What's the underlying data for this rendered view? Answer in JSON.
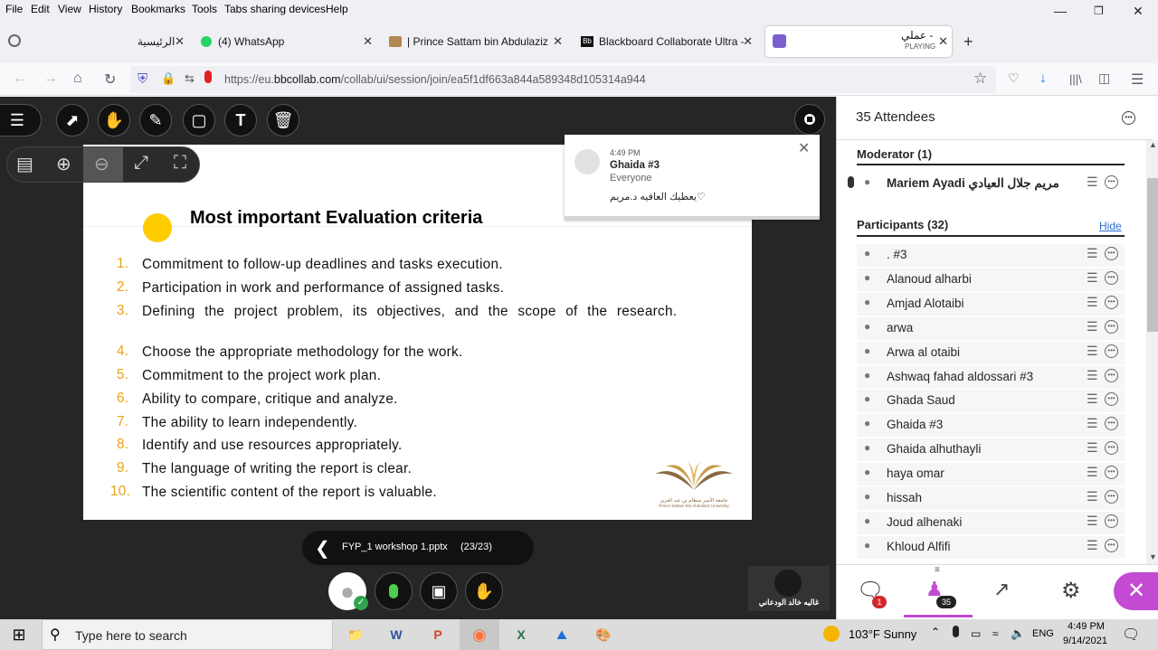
{
  "menubar": {
    "items": [
      "File",
      "Edit",
      "View",
      "History",
      "Bookmarks",
      "Tools",
      "Tabs sharing devices",
      "Help"
    ]
  },
  "tabs": [
    {
      "label": "الرئيسية",
      "icon": "green-leaf-icon"
    },
    {
      "label": "(4) WhatsApp",
      "icon": "whatsapp-icon"
    },
    {
      "label": "| Prince Sattam bin Abdulaziz Un",
      "icon": "university-logo-icon"
    },
    {
      "label": "Blackboard Collaborate Ultra - ...",
      "icon": "blackboard-icon"
    },
    {
      "label": "عملي -",
      "sublabel": "PLAYING",
      "icon": "purple-app-icon"
    }
  ],
  "navbar": {
    "url_host": "https://eu.",
    "url_domain": "bbcollab.com",
    "url_path": "/collab/ui/session/join/ea5f1df663a844a589348d105314a944"
  },
  "notification": {
    "time": "4:49 PM",
    "sender": "Ghaida #3",
    "audience": "Everyone",
    "message": "يعطيك العافيه د.مريم♡"
  },
  "slide": {
    "title": "Most important Evaluation criteria",
    "items": [
      {
        "num": "1.",
        "text": "Commitment to follow-up deadlines and tasks execution."
      },
      {
        "num": "2.",
        "text": "Participation in work and performance of assigned tasks."
      },
      {
        "num": "3.",
        "text": "Defining the project problem, its objectives, and the scope of the research."
      },
      {
        "num": "4.",
        "text": "Choose the appropriate methodology for the work."
      },
      {
        "num": "5.",
        "text": "Commitment to the project work plan."
      },
      {
        "num": "6.",
        "text": "Ability to compare, critique and analyze."
      },
      {
        "num": "7.",
        "text": "The ability to learn independently."
      },
      {
        "num": "8.",
        "text": "Identify and use resources appropriately."
      },
      {
        "num": "9.",
        "text": "The language of writing the report is clear."
      },
      {
        "num": "10.",
        "text": "The scientific content of the report is valuable."
      }
    ],
    "logo_text_ar": "جامعة الأمير سطام بن عبد العزيز",
    "logo_text_en": "Prince Sattam Bin Abdulaziz University"
  },
  "file": {
    "name": "FYP_1 workshop 1.pptx",
    "pages": "(23/23)"
  },
  "video_tile": {
    "name": "غاليه خالد الودعاني"
  },
  "sidebar": {
    "header": "35 Attendees",
    "moderator_heading": "Moderator (1)",
    "moderator": "Mariem Ayadi مريم جلال العيادي",
    "participants_heading": "Participants (32)",
    "hide_label": "Hide",
    "participants": [
      ". #3",
      "Alanoud alharbi",
      "Amjad Alotaibi",
      "arwa",
      "Arwa al otaibi",
      "Ashwaq fahad aldossari #3",
      "Ghada Saud",
      "Ghaida #3",
      "Ghaida alhuthayli",
      "haya omar",
      "hissah",
      "Joud alhenaki",
      "Khloud Alfifi"
    ],
    "chat_badge": "1",
    "attendee_badge": "35"
  },
  "taskbar": {
    "search_placeholder": "Type here to search",
    "weather": "103°F Sunny",
    "lang": "ENG",
    "time": "4:49 PM",
    "date": "9/14/2021"
  },
  "colors": {
    "accent_purple": "#c34bd3",
    "list_number": "#e8a317",
    "yellow_dot": "#ffcc00"
  }
}
